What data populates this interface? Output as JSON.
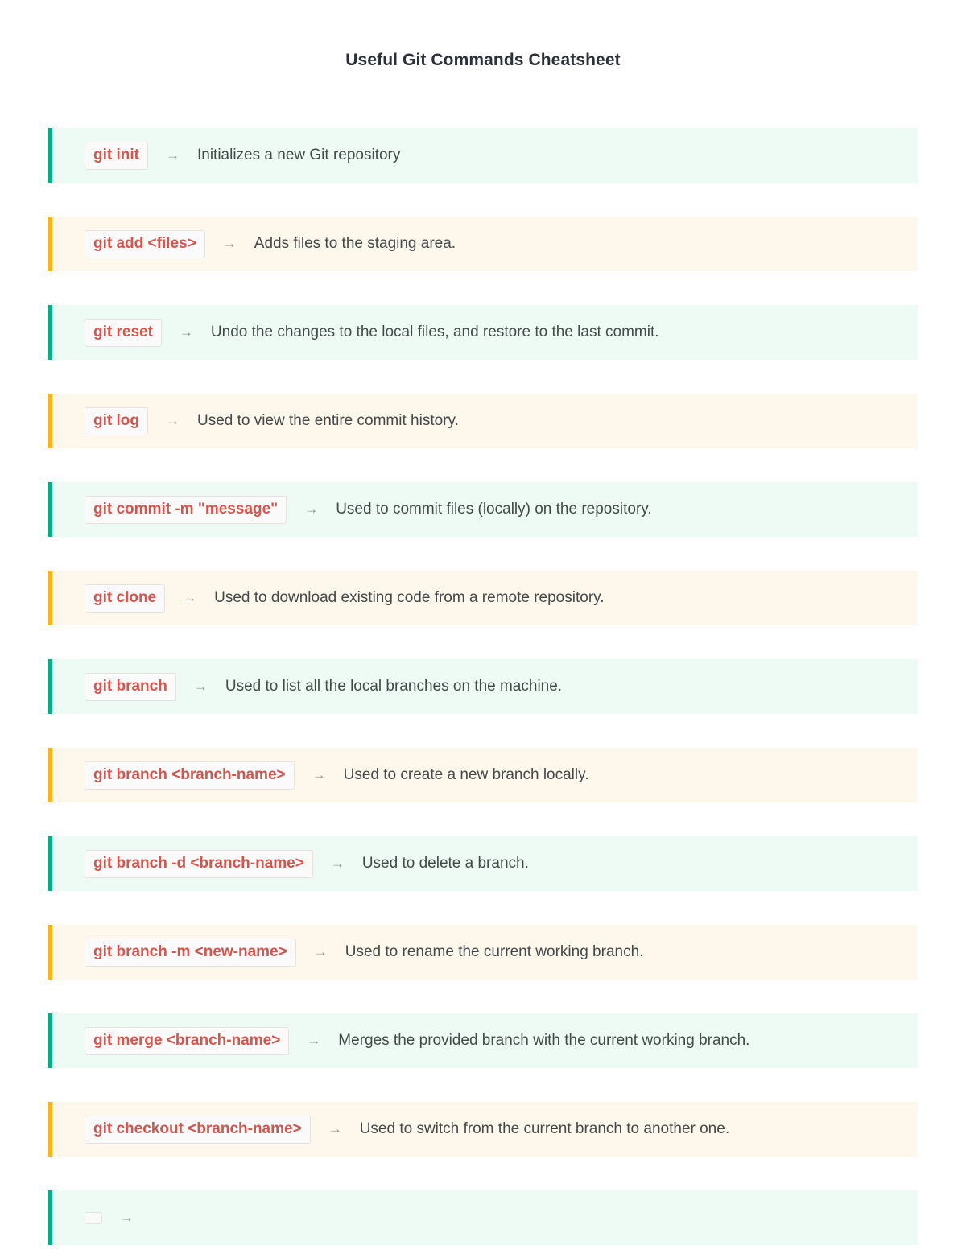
{
  "title": "Useful Git Commands Cheatsheet",
  "arrow_glyph": "→",
  "colors": {
    "green_accent": "#00b187",
    "green_background": "#edfbf4",
    "orange_accent": "#fbb415",
    "orange_background": "#fdf7ec",
    "command_text": "#d1564e",
    "description_text": "#444a4a",
    "title_text": "#2b2f3a",
    "badge_background": "#fbfafa",
    "badge_border": "#e4e3e3"
  },
  "rows": [
    {
      "command": "git init",
      "description": "Initializes a new Git repository",
      "accent": "green"
    },
    {
      "command": "git add <files>",
      "description": "Adds files to the staging area.",
      "accent": "orange"
    },
    {
      "command": "git reset",
      "description": "Undo the changes to the local files, and restore to the last commit.",
      "accent": "green"
    },
    {
      "command": "git log",
      "description": "Used to view the entire commit history.",
      "accent": "orange"
    },
    {
      "command": "git commit -m \"message\"",
      "description": "Used to commit files (locally) on the repository.",
      "accent": "green"
    },
    {
      "command": "git clone",
      "description": "Used to download existing code from a remote repository.",
      "accent": "orange"
    },
    {
      "command": "git branch",
      "description": "Used to list all the local branches on the machine.",
      "accent": "green"
    },
    {
      "command": "git branch <branch-name>",
      "description": "Used to create a new branch locally.",
      "accent": "orange"
    },
    {
      "command": "git branch -d <branch-name>",
      "description": "Used to delete a branch.",
      "accent": "green"
    },
    {
      "command": "git branch -m <new-name>",
      "description": "Used to rename the current working branch.",
      "accent": "orange"
    },
    {
      "command": "git merge <branch-name>",
      "description": "Merges the provided branch with the current working branch.",
      "accent": "green"
    },
    {
      "command": "git checkout <branch-name>",
      "description": "Used to switch from the current branch to another one.",
      "accent": "orange"
    },
    {
      "command": "",
      "description": "",
      "accent": "green"
    }
  ]
}
